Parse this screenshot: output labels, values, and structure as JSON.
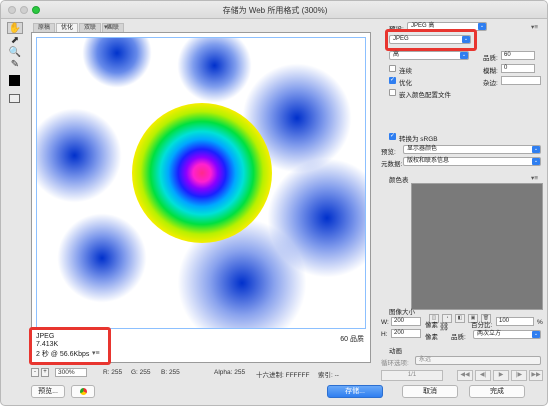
{
  "window": {
    "title": "存储为 Web 所用格式 (300%)",
    "traffic_colors": [
      "#c8c8c8",
      "#c8c8c8",
      "#2bc840"
    ]
  },
  "tools": [
    "hand-icon",
    "slice-select-icon",
    "zoom-icon",
    "eyedropper-icon",
    "color-swatch",
    "preview-toggle-icon"
  ],
  "tabs": [
    "原稿",
    "优化",
    "双联",
    "四联"
  ],
  "tabs_menu": "▾≡",
  "image_info": {
    "format": "JPEG",
    "size": "7.413K",
    "time": "2 秒 @ 56.6Kbps",
    "menu": "▾≡",
    "quality": "60 品质"
  },
  "status": {
    "zoom": "300%",
    "r": "R: 255",
    "g": "G: 255",
    "b": "B: 255",
    "alpha": "Alpha: 255",
    "hex": "十六进制: FFFFFF",
    "index": "索引: --",
    "minus": "-",
    "plus": "+"
  },
  "bottom": {
    "preview": "预览...",
    "save": "存储...",
    "cancel": "取消",
    "done": "完成"
  },
  "right": {
    "preset_label": "预设:",
    "preset_value": "JPEG 高",
    "menu": "▾≡",
    "format_value": "JPEG",
    "quality_option": "高",
    "quality_label": "品质:",
    "quality_value": "60",
    "blur_label": "模糊:",
    "blur_value": "0",
    "matte_label": "杂边:",
    "progressive": "连续",
    "optimized": "优化",
    "embed_profile": "嵌入颜色配置文件",
    "convert_srgb": "转换为 sRGB",
    "preview_label": "预览:",
    "preview_value": "显示器颜色",
    "metadata_label": "元数据:",
    "metadata_value": "版权和联系信息",
    "color_table_label": "颜色表",
    "color_table_menu": "▾≡",
    "image_size_label": "图像大小",
    "w_label": "W:",
    "w_value": "200",
    "h_label": "H:",
    "h_value": "200",
    "unit_px": "像素",
    "percent_label": "百分比:",
    "percent_value": "100",
    "percent_sign": "%",
    "quality_resample_label": "品质:",
    "quality_resample_value": "两次立方",
    "anim_label": "动画",
    "loop_label": "循环选项:",
    "loop_value": "永远",
    "frame_counter": "1/1"
  }
}
